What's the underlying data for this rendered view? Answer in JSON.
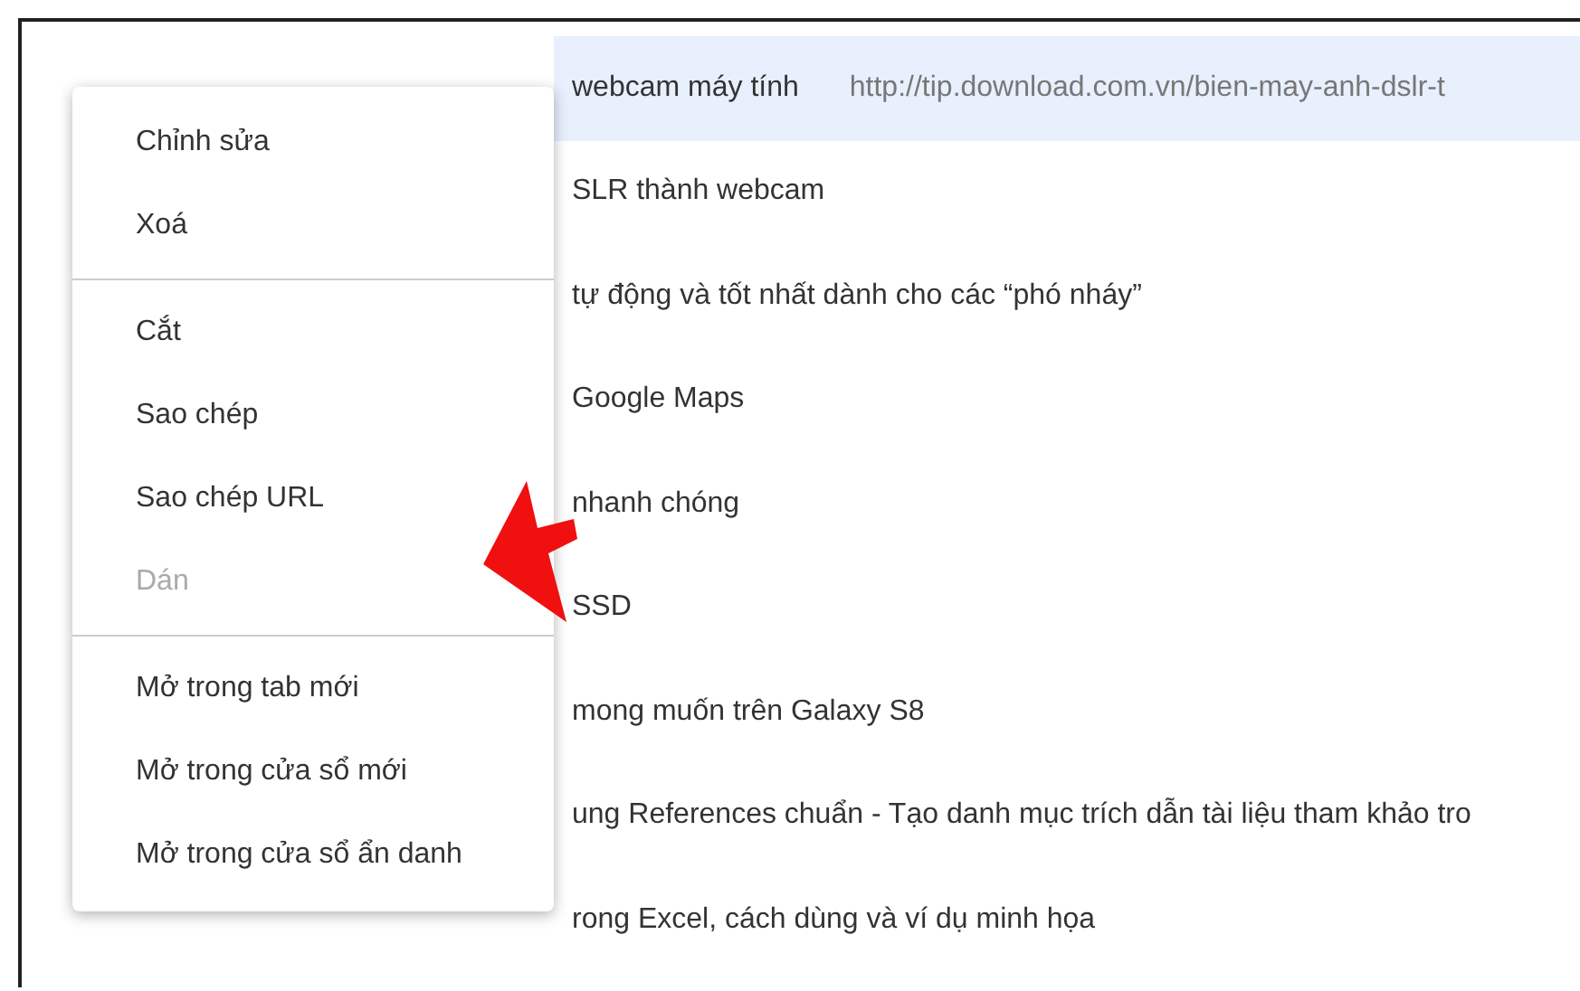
{
  "bookmarks": [
    {
      "title": "webcam máy tính",
      "url": "http://tip.download.com.vn/bien-may-anh-dslr-t",
      "selected": true
    },
    {
      "title": "SLR thành webcam",
      "selected": false
    },
    {
      "title": "tự động và tốt nhất dành cho các “phó nháy”",
      "selected": false
    },
    {
      "title": "Google Maps",
      "selected": false
    },
    {
      "title": "nhanh chóng",
      "selected": false
    },
    {
      "title": "SSD",
      "selected": false
    },
    {
      "title": "mong muốn trên Galaxy S8",
      "selected": false
    },
    {
      "title": "ung References chuẩn - Tạo danh mục trích dẫn tài liệu tham khảo tro",
      "selected": false
    },
    {
      "title": "rong Excel, cách dùng và ví dụ minh họa",
      "selected": false
    }
  ],
  "context_menu": {
    "sections": [
      [
        {
          "label": "Chỉnh sửa",
          "disabled": false
        },
        {
          "label": "Xoá",
          "disabled": false
        }
      ],
      [
        {
          "label": "Cắt",
          "disabled": false
        },
        {
          "label": "Sao chép",
          "disabled": false
        },
        {
          "label": "Sao chép URL",
          "disabled": false
        },
        {
          "label": "Dán",
          "disabled": true
        }
      ],
      [
        {
          "label": "Mở trong tab mới",
          "disabled": false
        },
        {
          "label": "Mở trong cửa sổ mới",
          "disabled": false
        },
        {
          "label": "Mở trong cửa sổ ẩn danh",
          "disabled": false
        }
      ]
    ]
  }
}
